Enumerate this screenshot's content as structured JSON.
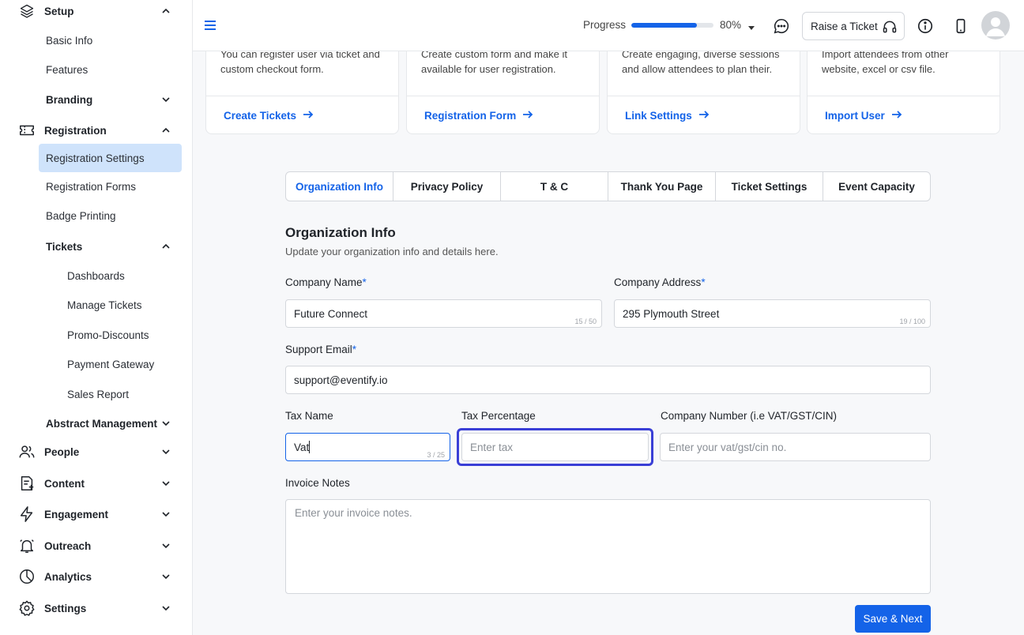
{
  "sidebar": {
    "setup": "Setup",
    "basic_info": "Basic Info",
    "features": "Features",
    "branding": "Branding",
    "registration": "Registration",
    "registration_settings": "Registration Settings",
    "registration_forms": "Registration Forms",
    "badge_printing": "Badge Printing",
    "tickets": "Tickets",
    "dashboards": "Dashboards",
    "manage_tickets": "Manage Tickets",
    "promo_discounts": "Promo-Discounts",
    "payment_gateway": "Payment Gateway",
    "sales_report": "Sales Report",
    "abstract_management": "Abstract Management",
    "people": "People",
    "content": "Content",
    "engagement": "Engagement",
    "outreach": "Outreach",
    "analytics": "Analytics",
    "settings": "Settings"
  },
  "topbar": {
    "progress_label": "Progress",
    "progress_value": 0.8,
    "progress_pct": "80%",
    "raise_ticket": "Raise a Ticket"
  },
  "cards": [
    {
      "desc": "You can register user via ticket and custom checkout form.",
      "link": "Create Tickets"
    },
    {
      "desc": "Create custom form and make it available for user registration.",
      "link": "Registration Form"
    },
    {
      "desc": "Create engaging, diverse sessions and allow attendees to plan their.",
      "link": "Link Settings"
    },
    {
      "desc": "Import attendees from other website, excel or csv file.",
      "link": "Import User"
    }
  ],
  "tabs": [
    "Organization Info",
    "Privacy Policy",
    "T & C",
    "Thank You Page",
    "Ticket Settings",
    "Event Capacity"
  ],
  "form": {
    "title": "Organization Info",
    "subtitle": "Update your organization info and details here.",
    "company_name_label": "Company Name",
    "company_name_value": "Future Connect",
    "company_name_count": "15 / 50",
    "company_address_label": "Company Address",
    "company_address_value": "295 Plymouth Street",
    "company_address_count": "19 / 100",
    "support_email_label": "Support Email",
    "support_email_value": "support@eventify.io",
    "tax_name_label": "Tax Name",
    "tax_name_value": "Vat",
    "tax_name_count": "3 / 25",
    "tax_pct_label": "Tax Percentage",
    "tax_pct_placeholder": "Enter tax",
    "company_number_label": "Company Number (i.e VAT/GST/CIN)",
    "company_number_placeholder": "Enter your vat/gst/cin no.",
    "invoice_notes_label": "Invoice Notes",
    "invoice_notes_placeholder": "Enter your invoice notes.",
    "required_mark": "*",
    "save_next": "Save & Next"
  },
  "colors": {
    "accent": "#1463e8",
    "focus": "#3a3fd6",
    "active_nav": "#cfe3fb"
  }
}
